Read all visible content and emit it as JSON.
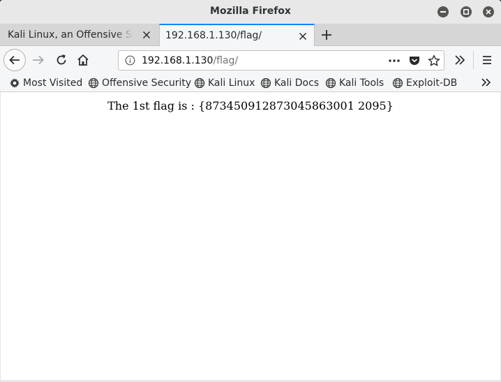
{
  "window": {
    "title": "Mozilla Firefox"
  },
  "tabs": [
    {
      "label": "Kali Linux, an Offensive Secu",
      "active": false
    },
    {
      "label": "192.168.1.130/flag/",
      "active": true
    }
  ],
  "urlbar": {
    "host": "192.168.1.130",
    "path": "/flag/"
  },
  "bookmarks": [
    {
      "label": "Most Visited",
      "icon": "gear-icon"
    },
    {
      "label": "Offensive Security",
      "icon": "globe-icon"
    },
    {
      "label": "Kali Linux",
      "icon": "globe-icon"
    },
    {
      "label": "Kali Docs",
      "icon": "globe-icon"
    },
    {
      "label": "Kali Tools",
      "icon": "globe-icon"
    },
    {
      "label": "Exploit-DB",
      "icon": "globe-icon"
    }
  ],
  "page": {
    "text": "The 1st flag is : {873450912873045863001 2095}"
  },
  "colors": {
    "tab_accent": "#0a84ff",
    "window_button": "#555753"
  }
}
